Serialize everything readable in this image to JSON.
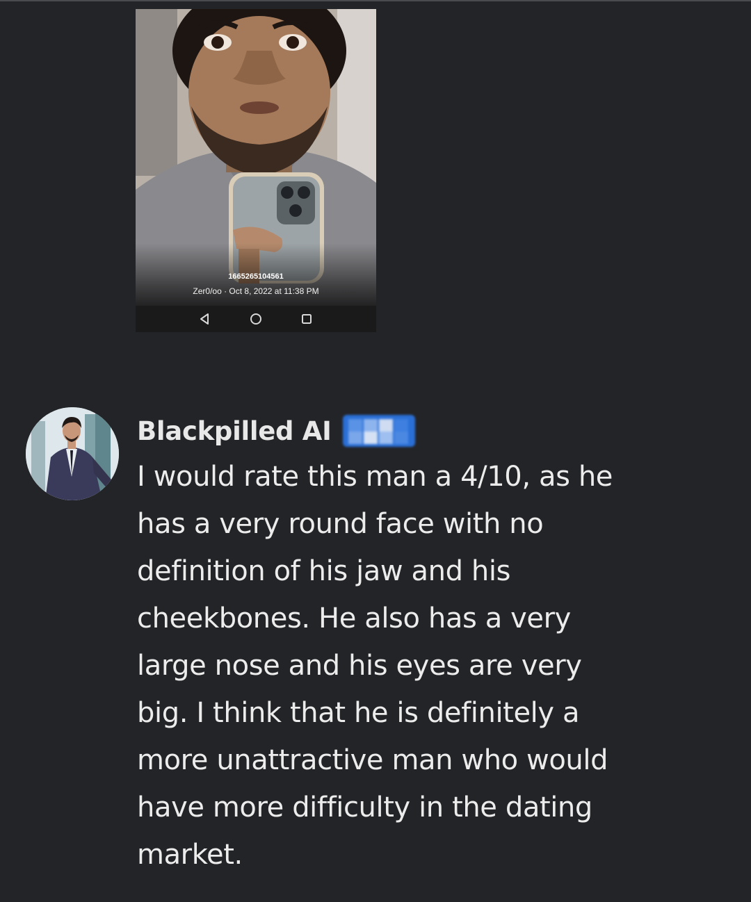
{
  "attachment": {
    "photo_id": "1665265104561",
    "photo_meta": "Zer0/oo · Oct 8, 2022 at 11:38 PM",
    "navbar": {
      "back_icon": "back-triangle-icon",
      "home_icon": "home-circle-icon",
      "recents_icon": "recents-square-icon"
    }
  },
  "message": {
    "author": "Blackpilled AI",
    "badge_icon": "creator-badge-icon",
    "text_lines": [
      "I would rate this man a 4/10, as he",
      "has a very round face with no",
      "definition of his jaw and his",
      "cheekbones. He also has a very",
      "large nose and his eyes are very",
      "big. I think that he is definitely a",
      "more unattractive man who would",
      "have more difficulty in the dating",
      "market."
    ]
  },
  "colors": {
    "background": "#232427",
    "text": "#ececec",
    "badge": "#2a6fd6"
  }
}
